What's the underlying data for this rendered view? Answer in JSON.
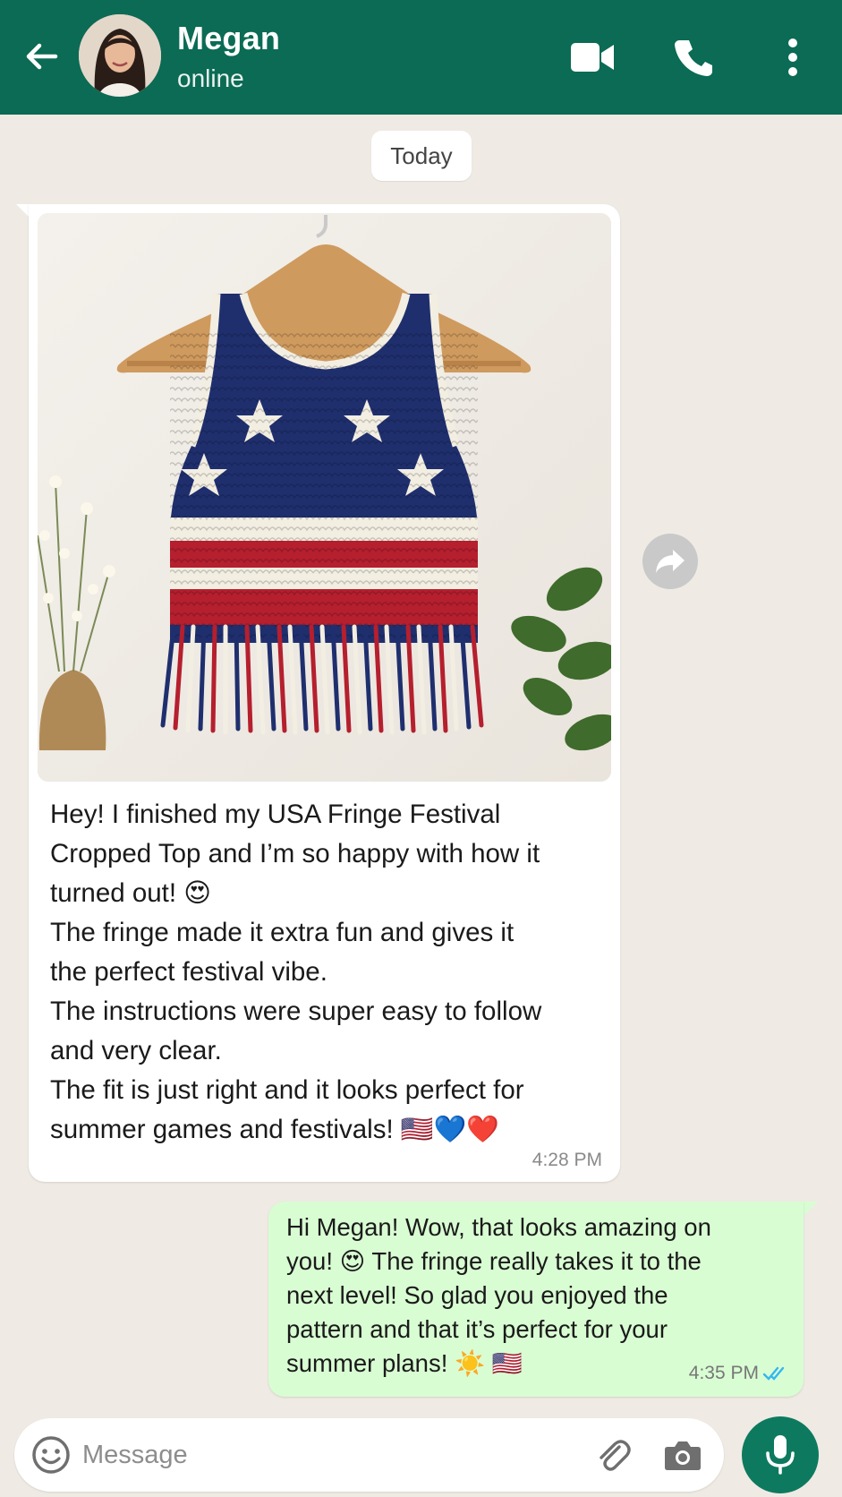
{
  "header": {
    "contact_name": "Megan",
    "status": "online",
    "colors": {
      "bar": "#0b6b55"
    },
    "icons": [
      "back-arrow-icon",
      "avatar",
      "video-call-icon",
      "phone-icon",
      "more-vertical-icon"
    ]
  },
  "chat": {
    "date_chip": "Today",
    "incoming": {
      "image_name": "crocheted-usa-fringe-crop-top-photo",
      "lines": [
        "Hey! I finished my USA Fringe Festival",
        "Cropped Top and I’m so happy with how it",
        "turned out! 😍",
        "The fringe made it extra fun and gives it",
        "the perfect festival vibe.",
        "The instructions were super easy to follow",
        "and very clear.",
        "The fit is just right and it looks perfect for",
        "summer games and festivals! 🇺🇸💙❤️"
      ],
      "time": "4:28 PM"
    },
    "outgoing": {
      "lines": [
        "Hi Megan! Wow, that looks amazing on",
        "you! 😍 The fringe really takes it to the",
        "next level! So glad you enjoyed the",
        "pattern and that it’s perfect for your",
        "summer plans! ☀️ 🇺🇸"
      ],
      "time": "4:35 PM",
      "status_icon": "double-check-read-icon",
      "colors": {
        "bubble": "#d9fdd3",
        "ticks": "#34b7f1"
      }
    }
  },
  "composer": {
    "placeholder": "Message",
    "icons": [
      "emoji-icon",
      "paperclip-icon",
      "camera-icon",
      "microphone-icon"
    ],
    "colors": {
      "mic_button": "#0d7a5f"
    }
  }
}
